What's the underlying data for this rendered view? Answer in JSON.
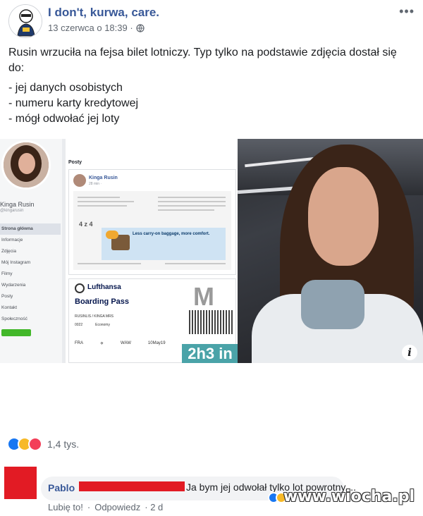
{
  "post": {
    "page_name": "I don't, kurwa, care.",
    "date": "13 czerwca o 18:39 ·",
    "more_icon": "more-horizontal-icon",
    "privacy_icon": "globe-icon",
    "text_intro": "Rusin wrzuciła na fejsa bilet lotniczy. Typ tylko na podstawie zdjęcia dostał się do:",
    "bullets": [
      "- jej danych osobistych",
      "- numeru karty kredytowej",
      "- mógł odwołać jej loty"
    ]
  },
  "screenshot": {
    "profile_name": "Kinga Rusin",
    "profile_handle": "@kingarusin",
    "side_items": [
      "Strona główna",
      "Informacje",
      "Zdjęcia",
      "Mój Instagram",
      "Filmy",
      "Wydarzenia",
      "Posty",
      "Kontakt",
      "Społeczność"
    ],
    "posts_label": "Posty",
    "inner_name": "Kinga Rusin",
    "inner_time": "28 min · ",
    "seat_label": "4 z 4",
    "promo_text": "Less carry-on baggage, more comfort.",
    "airline": "Lufthansa",
    "bp_title": "Boarding Pass",
    "bp_big": "M",
    "bp_names": "RUSINLIS / KINGA MRS",
    "bp_flight": "0022",
    "bp_class": "Economy",
    "bp_from": "FRA",
    "bp_to": "WAW",
    "bp_date": "10May19",
    "gate": "2h3 in"
  },
  "reactions": {
    "count": "1,4 tys.",
    "types": [
      "like",
      "haha",
      "love"
    ]
  },
  "comment": {
    "author": "Pablo",
    "text": "Ja bym jej odwołał tylko lot powrotny....",
    "like_label": "Lubię to!",
    "reply_label": "Odpowiedz",
    "age": "· 2 d",
    "separator": "·"
  },
  "watermark": "www.wiocha.pl",
  "colors": {
    "link_blue": "#385898",
    "redaction_red": "#e21b24",
    "like_blue": "#1877f2"
  }
}
